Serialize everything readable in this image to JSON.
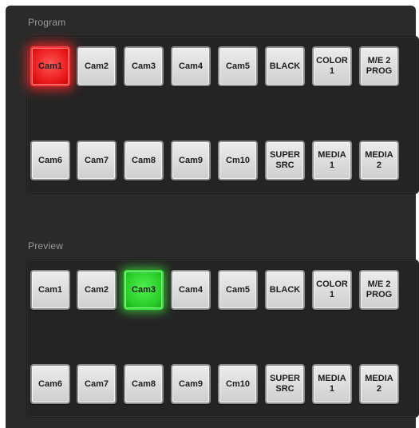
{
  "program": {
    "label": "Program",
    "row1": [
      "Cam1",
      "Cam2",
      "Cam3",
      "Cam4",
      "Cam5",
      "BLACK",
      "COLOR\n1",
      "M/E 2\nPROG"
    ],
    "row2": [
      "Cam6",
      "Cam7",
      "Cam8",
      "Cam9",
      "Cm10",
      "SUPER\nSRC",
      "MEDIA\n1",
      "MEDIA\n2"
    ],
    "active": "Cam1"
  },
  "preview": {
    "label": "Preview",
    "row1": [
      "Cam1",
      "Cam2",
      "Cam3",
      "Cam4",
      "Cam5",
      "BLACK",
      "COLOR\n1",
      "M/E 2\nPROG"
    ],
    "row2": [
      "Cam6",
      "Cam7",
      "Cam8",
      "Cam9",
      "Cm10",
      "SUPER\nSRC",
      "MEDIA\n1",
      "MEDIA\n2"
    ],
    "active": "Cam3"
  },
  "colors": {
    "program_tally": "#e81616",
    "preview_tally": "#26cc26",
    "panel_bg": "#2a2a2a"
  }
}
